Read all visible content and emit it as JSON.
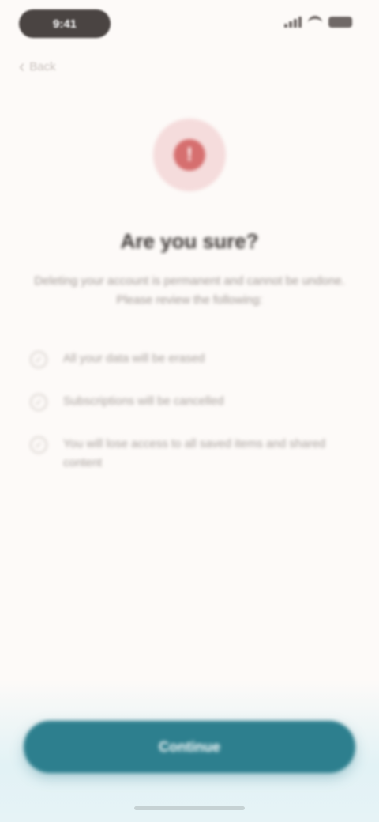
{
  "status_bar": {
    "time": "9:41"
  },
  "nav": {
    "back_label": "Back"
  },
  "hero": {
    "icon": "alert-icon",
    "title": "Are you sure?",
    "subtitle": "Deleting your account is permanent and cannot be undone. Please review the following:"
  },
  "checklist": [
    {
      "text": "All your data will be erased",
      "icon": "check-icon"
    },
    {
      "text": "Subscriptions will be cancelled",
      "icon": "check-icon"
    },
    {
      "text": "You will lose access to all saved items and shared content",
      "icon": "check-icon"
    }
  ],
  "footer": {
    "primary_button_label": "Continue"
  },
  "colors": {
    "background": "#fdfaf8",
    "accent": "#2d7f8e",
    "danger": "#d66f6f"
  }
}
